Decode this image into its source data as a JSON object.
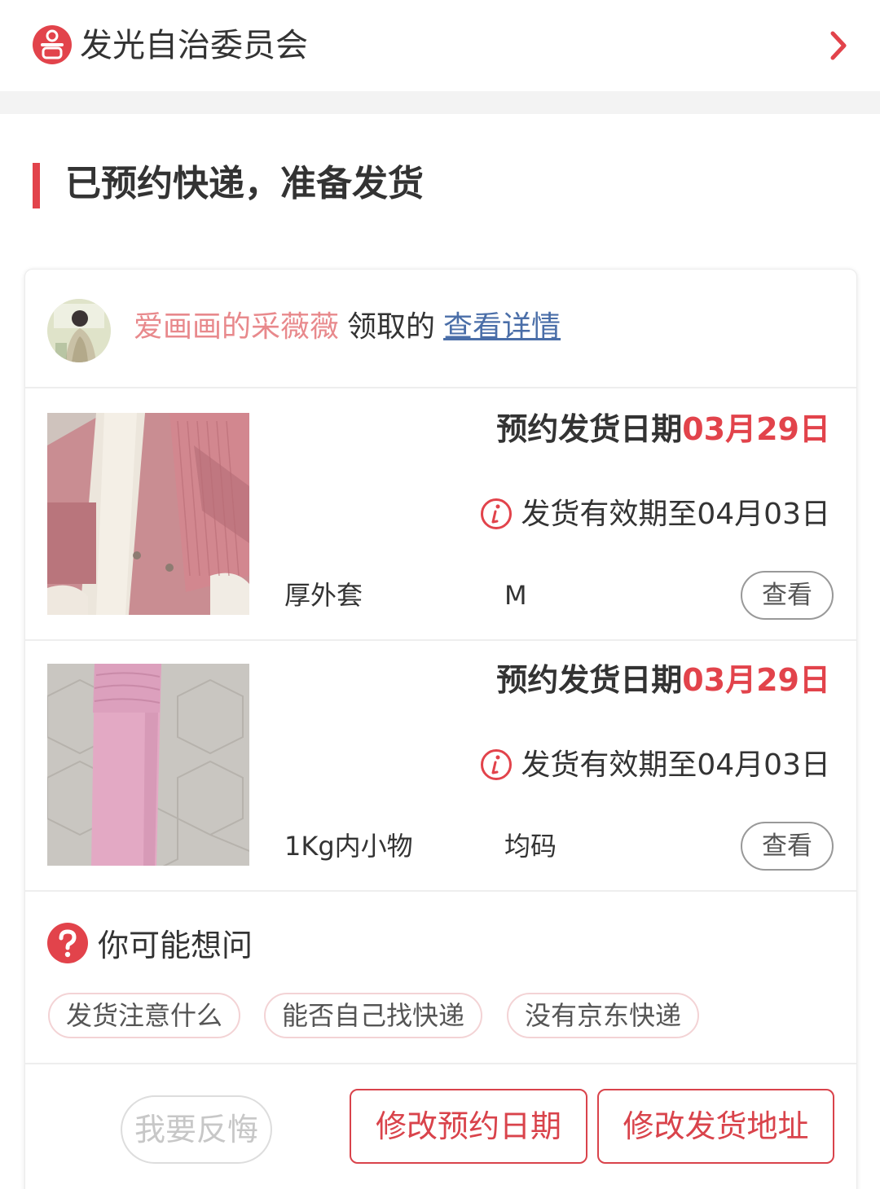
{
  "org": {
    "name": "发光自治委员会"
  },
  "status": {
    "title": "已预约快递，准备发货"
  },
  "receiver": {
    "user": "爱画画的采薇薇",
    "action": "领取的",
    "link": "查看详情"
  },
  "items": [
    {
      "ship_label": "预约发货日期",
      "ship_date": "03月29日",
      "valid_text": "发货有效期至04月03日",
      "name": "厚外套",
      "size": "M",
      "view_label": "查看"
    },
    {
      "ship_label": "预约发货日期",
      "ship_date": "03月29日",
      "valid_text": "发货有效期至04月03日",
      "name": "1Kg内小物",
      "size": "均码",
      "view_label": "查看"
    }
  ],
  "faq": {
    "title": "你可能想问",
    "chips": [
      "发货注意什么",
      "能否自己找快递",
      "没有京东快递"
    ]
  },
  "actions": {
    "regret": "我要反悔",
    "modify_date": "修改预约日期",
    "modify_address": "修改发货地址"
  },
  "colors": {
    "accent": "#e2434b",
    "username": "#e8898c",
    "link": "#4a6ea8"
  }
}
